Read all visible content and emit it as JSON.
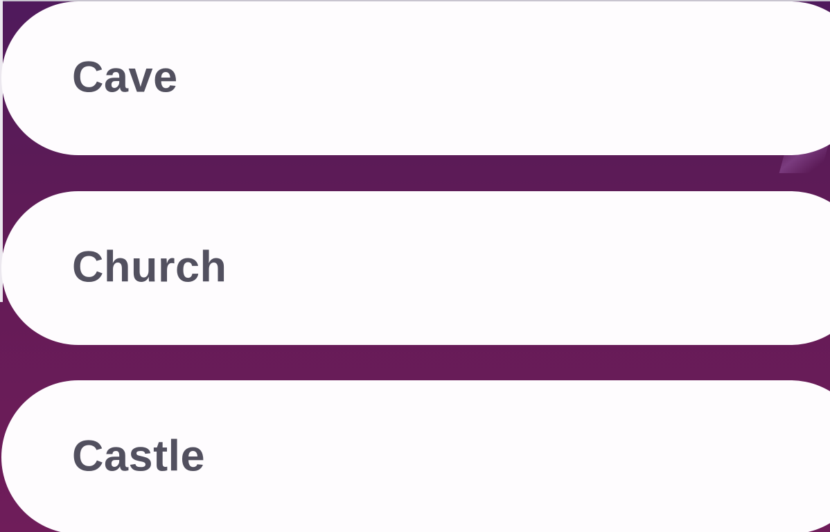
{
  "options": [
    {
      "label": "Cave"
    },
    {
      "label": "Church"
    },
    {
      "label": "Castle"
    }
  ],
  "colors": {
    "background_top": "#4f1a5c",
    "background_bottom": "#6f1d5a",
    "option_fill": "#fefcfe",
    "label_text": "#52505f"
  }
}
